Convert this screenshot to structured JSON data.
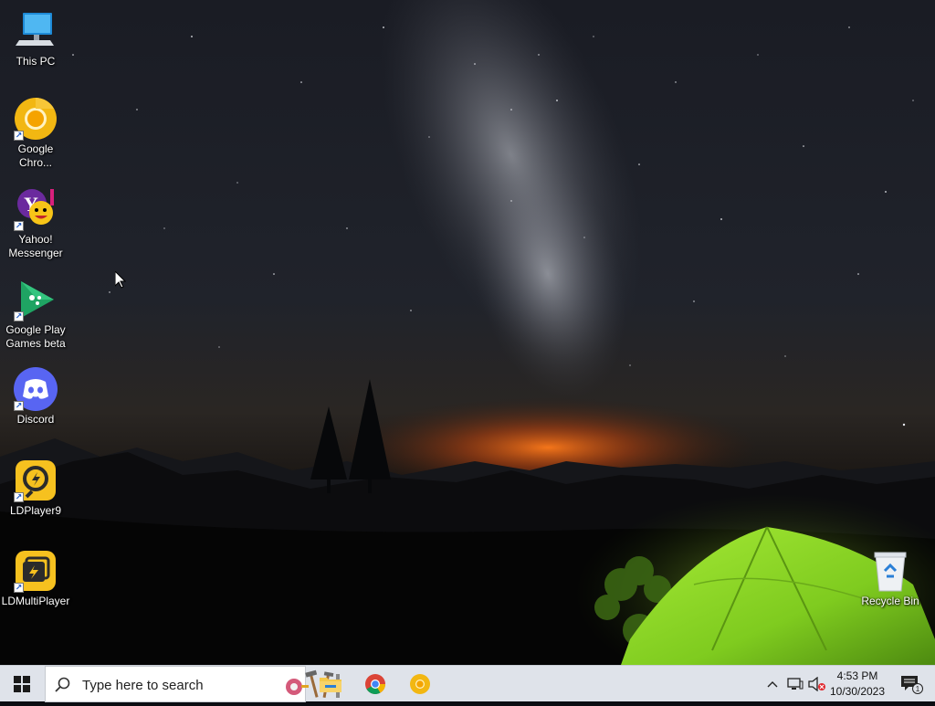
{
  "desktop": {
    "icons": [
      {
        "name": "this-pc",
        "label": "This PC",
        "icon": "computer-icon"
      },
      {
        "name": "google-chrome",
        "label": "Google Chro...",
        "icon": "chrome-canary-icon",
        "shortcut": true
      },
      {
        "name": "yahoo-messenger",
        "label": "Yahoo! Messenger",
        "icon": "yahoo-messenger-icon",
        "shortcut": true
      },
      {
        "name": "google-play-games",
        "label": "Google Play Games beta",
        "icon": "play-games-icon",
        "shortcut": true
      },
      {
        "name": "discord",
        "label": "Discord",
        "icon": "discord-icon",
        "shortcut": true
      },
      {
        "name": "ldplayer9",
        "label": "LDPlayer9",
        "icon": "ldplayer-icon",
        "shortcut": true
      },
      {
        "name": "ldmultiplayer",
        "label": "LDMultiPlayer",
        "icon": "ldmultiplayer-icon",
        "shortcut": true
      },
      {
        "name": "recycle-bin",
        "label": "Recycle Bin",
        "icon": "recycle-bin-icon"
      }
    ]
  },
  "taskbar": {
    "search_placeholder": "Type here to search",
    "pinned": [
      "file-explorer-icon",
      "chrome-icon",
      "chrome-canary-icon"
    ],
    "clock": {
      "time": "4:53 PM",
      "date": "10/30/2023"
    },
    "notification_count": "1"
  },
  "colors": {
    "taskbar_bg": "#dfe3ea",
    "accent_blue": "#0078d7",
    "tent_green": "#8cd42a"
  }
}
